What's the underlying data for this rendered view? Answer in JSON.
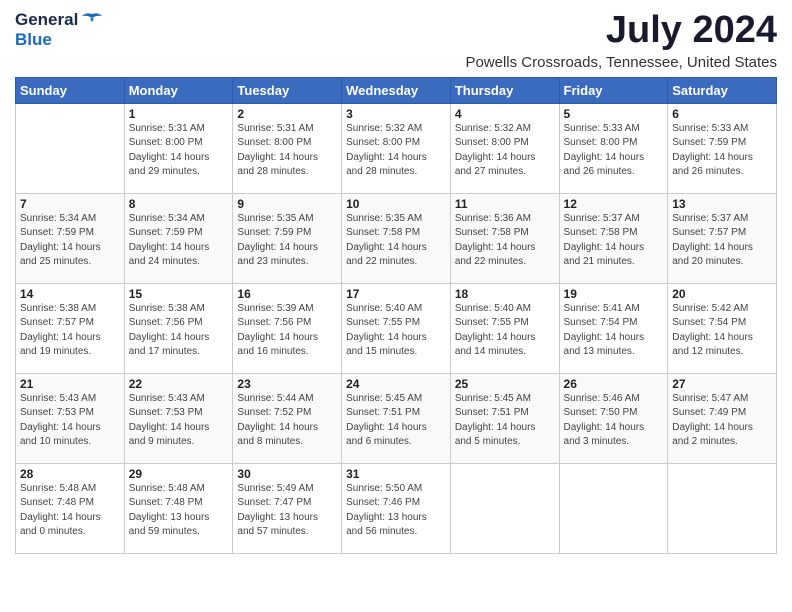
{
  "logo": {
    "general": "General",
    "blue": "Blue"
  },
  "title": {
    "month": "July 2024",
    "location": "Powells Crossroads, Tennessee, United States"
  },
  "weekdays": [
    "Sunday",
    "Monday",
    "Tuesday",
    "Wednesday",
    "Thursday",
    "Friday",
    "Saturday"
  ],
  "weeks": [
    [
      {
        "day": "",
        "info": ""
      },
      {
        "day": "1",
        "info": "Sunrise: 5:31 AM\nSunset: 8:00 PM\nDaylight: 14 hours\nand 29 minutes."
      },
      {
        "day": "2",
        "info": "Sunrise: 5:31 AM\nSunset: 8:00 PM\nDaylight: 14 hours\nand 28 minutes."
      },
      {
        "day": "3",
        "info": "Sunrise: 5:32 AM\nSunset: 8:00 PM\nDaylight: 14 hours\nand 28 minutes."
      },
      {
        "day": "4",
        "info": "Sunrise: 5:32 AM\nSunset: 8:00 PM\nDaylight: 14 hours\nand 27 minutes."
      },
      {
        "day": "5",
        "info": "Sunrise: 5:33 AM\nSunset: 8:00 PM\nDaylight: 14 hours\nand 26 minutes."
      },
      {
        "day": "6",
        "info": "Sunrise: 5:33 AM\nSunset: 7:59 PM\nDaylight: 14 hours\nand 26 minutes."
      }
    ],
    [
      {
        "day": "7",
        "info": "Sunrise: 5:34 AM\nSunset: 7:59 PM\nDaylight: 14 hours\nand 25 minutes."
      },
      {
        "day": "8",
        "info": "Sunrise: 5:34 AM\nSunset: 7:59 PM\nDaylight: 14 hours\nand 24 minutes."
      },
      {
        "day": "9",
        "info": "Sunrise: 5:35 AM\nSunset: 7:59 PM\nDaylight: 14 hours\nand 23 minutes."
      },
      {
        "day": "10",
        "info": "Sunrise: 5:35 AM\nSunset: 7:58 PM\nDaylight: 14 hours\nand 22 minutes."
      },
      {
        "day": "11",
        "info": "Sunrise: 5:36 AM\nSunset: 7:58 PM\nDaylight: 14 hours\nand 22 minutes."
      },
      {
        "day": "12",
        "info": "Sunrise: 5:37 AM\nSunset: 7:58 PM\nDaylight: 14 hours\nand 21 minutes."
      },
      {
        "day": "13",
        "info": "Sunrise: 5:37 AM\nSunset: 7:57 PM\nDaylight: 14 hours\nand 20 minutes."
      }
    ],
    [
      {
        "day": "14",
        "info": "Sunrise: 5:38 AM\nSunset: 7:57 PM\nDaylight: 14 hours\nand 19 minutes."
      },
      {
        "day": "15",
        "info": "Sunrise: 5:38 AM\nSunset: 7:56 PM\nDaylight: 14 hours\nand 17 minutes."
      },
      {
        "day": "16",
        "info": "Sunrise: 5:39 AM\nSunset: 7:56 PM\nDaylight: 14 hours\nand 16 minutes."
      },
      {
        "day": "17",
        "info": "Sunrise: 5:40 AM\nSunset: 7:55 PM\nDaylight: 14 hours\nand 15 minutes."
      },
      {
        "day": "18",
        "info": "Sunrise: 5:40 AM\nSunset: 7:55 PM\nDaylight: 14 hours\nand 14 minutes."
      },
      {
        "day": "19",
        "info": "Sunrise: 5:41 AM\nSunset: 7:54 PM\nDaylight: 14 hours\nand 13 minutes."
      },
      {
        "day": "20",
        "info": "Sunrise: 5:42 AM\nSunset: 7:54 PM\nDaylight: 14 hours\nand 12 minutes."
      }
    ],
    [
      {
        "day": "21",
        "info": "Sunrise: 5:43 AM\nSunset: 7:53 PM\nDaylight: 14 hours\nand 10 minutes."
      },
      {
        "day": "22",
        "info": "Sunrise: 5:43 AM\nSunset: 7:53 PM\nDaylight: 14 hours\nand 9 minutes."
      },
      {
        "day": "23",
        "info": "Sunrise: 5:44 AM\nSunset: 7:52 PM\nDaylight: 14 hours\nand 8 minutes."
      },
      {
        "day": "24",
        "info": "Sunrise: 5:45 AM\nSunset: 7:51 PM\nDaylight: 14 hours\nand 6 minutes."
      },
      {
        "day": "25",
        "info": "Sunrise: 5:45 AM\nSunset: 7:51 PM\nDaylight: 14 hours\nand 5 minutes."
      },
      {
        "day": "26",
        "info": "Sunrise: 5:46 AM\nSunset: 7:50 PM\nDaylight: 14 hours\nand 3 minutes."
      },
      {
        "day": "27",
        "info": "Sunrise: 5:47 AM\nSunset: 7:49 PM\nDaylight: 14 hours\nand 2 minutes."
      }
    ],
    [
      {
        "day": "28",
        "info": "Sunrise: 5:48 AM\nSunset: 7:48 PM\nDaylight: 14 hours\nand 0 minutes."
      },
      {
        "day": "29",
        "info": "Sunrise: 5:48 AM\nSunset: 7:48 PM\nDaylight: 13 hours\nand 59 minutes."
      },
      {
        "day": "30",
        "info": "Sunrise: 5:49 AM\nSunset: 7:47 PM\nDaylight: 13 hours\nand 57 minutes."
      },
      {
        "day": "31",
        "info": "Sunrise: 5:50 AM\nSunset: 7:46 PM\nDaylight: 13 hours\nand 56 minutes."
      },
      {
        "day": "",
        "info": ""
      },
      {
        "day": "",
        "info": ""
      },
      {
        "day": "",
        "info": ""
      }
    ]
  ]
}
